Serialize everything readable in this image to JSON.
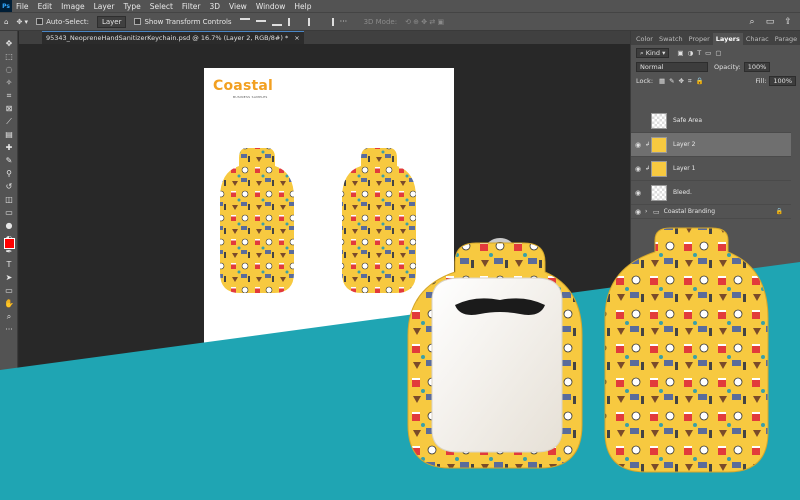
{
  "app": {
    "logo": "Ps"
  },
  "menu": [
    "File",
    "Edit",
    "Image",
    "Layer",
    "Type",
    "Select",
    "Filter",
    "3D",
    "View",
    "Window",
    "Help"
  ],
  "options_bar": {
    "auto_select_label": "Auto-Select:",
    "auto_select_value": "Layer",
    "transform_label": "Show Transform Controls",
    "mode_3d_label": "3D Mode:"
  },
  "document": {
    "tab_title": "95343_NeopreneHandSanitizerKeychain.psd @ 16.7% (Layer 2, RGB/8#) *",
    "brand_name": "Coastal",
    "brand_sub": "BUSINESS SAMPLES"
  },
  "colors": {
    "foreground": "#ff0000",
    "background": "#000000",
    "teal": "#1fa5b3",
    "yellow": "#f7c940"
  },
  "panel": {
    "tabs": [
      "Color",
      "Swatch",
      "Proper",
      "Layers",
      "Charac",
      "Parage"
    ],
    "active_tab": "Layers",
    "filter_kind": "Kind",
    "blend_mode": "Normal",
    "opacity_label": "Opacity:",
    "opacity_value": "100%",
    "lock_label": "Lock:",
    "fill_label": "Fill:",
    "fill_value": "100%",
    "layers": [
      {
        "name": "Safe Area",
        "visible": false
      },
      {
        "name": "Layer 2",
        "visible": true,
        "selected": true
      },
      {
        "name": "Layer 1",
        "visible": true
      },
      {
        "name": "Bleed.",
        "visible": true
      },
      {
        "name": "Coastal Branding",
        "visible": true,
        "group": true,
        "locked": true
      }
    ]
  }
}
